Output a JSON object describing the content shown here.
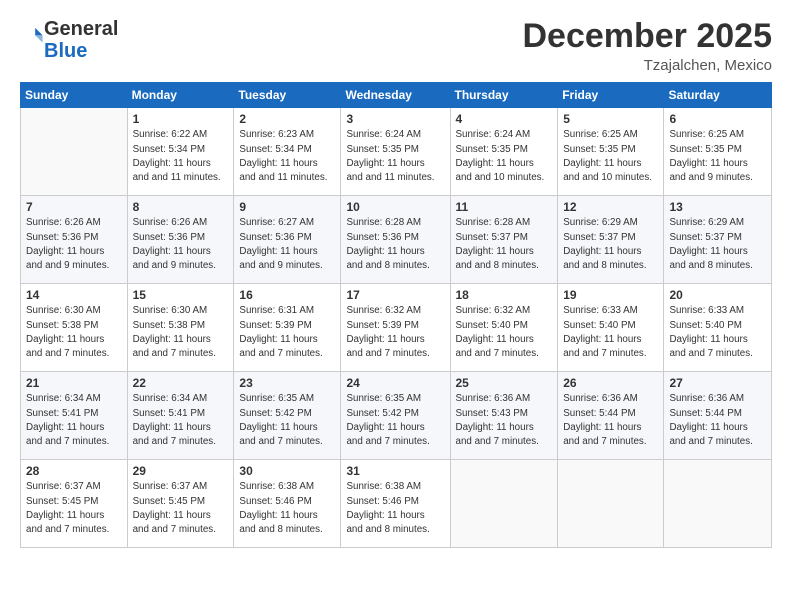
{
  "header": {
    "logo_general": "General",
    "logo_blue": "Blue",
    "month_title": "December 2025",
    "location": "Tzajalchen, Mexico"
  },
  "days_of_week": [
    "Sunday",
    "Monday",
    "Tuesday",
    "Wednesday",
    "Thursday",
    "Friday",
    "Saturday"
  ],
  "weeks": [
    [
      {
        "day": "",
        "sunrise": "",
        "sunset": "",
        "daylight": ""
      },
      {
        "day": "1",
        "sunrise": "Sunrise: 6:22 AM",
        "sunset": "Sunset: 5:34 PM",
        "daylight": "Daylight: 11 hours and 11 minutes."
      },
      {
        "day": "2",
        "sunrise": "Sunrise: 6:23 AM",
        "sunset": "Sunset: 5:34 PM",
        "daylight": "Daylight: 11 hours and 11 minutes."
      },
      {
        "day": "3",
        "sunrise": "Sunrise: 6:24 AM",
        "sunset": "Sunset: 5:35 PM",
        "daylight": "Daylight: 11 hours and 11 minutes."
      },
      {
        "day": "4",
        "sunrise": "Sunrise: 6:24 AM",
        "sunset": "Sunset: 5:35 PM",
        "daylight": "Daylight: 11 hours and 10 minutes."
      },
      {
        "day": "5",
        "sunrise": "Sunrise: 6:25 AM",
        "sunset": "Sunset: 5:35 PM",
        "daylight": "Daylight: 11 hours and 10 minutes."
      },
      {
        "day": "6",
        "sunrise": "Sunrise: 6:25 AM",
        "sunset": "Sunset: 5:35 PM",
        "daylight": "Daylight: 11 hours and 9 minutes."
      }
    ],
    [
      {
        "day": "7",
        "sunrise": "Sunrise: 6:26 AM",
        "sunset": "Sunset: 5:36 PM",
        "daylight": "Daylight: 11 hours and 9 minutes."
      },
      {
        "day": "8",
        "sunrise": "Sunrise: 6:26 AM",
        "sunset": "Sunset: 5:36 PM",
        "daylight": "Daylight: 11 hours and 9 minutes."
      },
      {
        "day": "9",
        "sunrise": "Sunrise: 6:27 AM",
        "sunset": "Sunset: 5:36 PM",
        "daylight": "Daylight: 11 hours and 9 minutes."
      },
      {
        "day": "10",
        "sunrise": "Sunrise: 6:28 AM",
        "sunset": "Sunset: 5:36 PM",
        "daylight": "Daylight: 11 hours and 8 minutes."
      },
      {
        "day": "11",
        "sunrise": "Sunrise: 6:28 AM",
        "sunset": "Sunset: 5:37 PM",
        "daylight": "Daylight: 11 hours and 8 minutes."
      },
      {
        "day": "12",
        "sunrise": "Sunrise: 6:29 AM",
        "sunset": "Sunset: 5:37 PM",
        "daylight": "Daylight: 11 hours and 8 minutes."
      },
      {
        "day": "13",
        "sunrise": "Sunrise: 6:29 AM",
        "sunset": "Sunset: 5:37 PM",
        "daylight": "Daylight: 11 hours and 8 minutes."
      }
    ],
    [
      {
        "day": "14",
        "sunrise": "Sunrise: 6:30 AM",
        "sunset": "Sunset: 5:38 PM",
        "daylight": "Daylight: 11 hours and 7 minutes."
      },
      {
        "day": "15",
        "sunrise": "Sunrise: 6:30 AM",
        "sunset": "Sunset: 5:38 PM",
        "daylight": "Daylight: 11 hours and 7 minutes."
      },
      {
        "day": "16",
        "sunrise": "Sunrise: 6:31 AM",
        "sunset": "Sunset: 5:39 PM",
        "daylight": "Daylight: 11 hours and 7 minutes."
      },
      {
        "day": "17",
        "sunrise": "Sunrise: 6:32 AM",
        "sunset": "Sunset: 5:39 PM",
        "daylight": "Daylight: 11 hours and 7 minutes."
      },
      {
        "day": "18",
        "sunrise": "Sunrise: 6:32 AM",
        "sunset": "Sunset: 5:40 PM",
        "daylight": "Daylight: 11 hours and 7 minutes."
      },
      {
        "day": "19",
        "sunrise": "Sunrise: 6:33 AM",
        "sunset": "Sunset: 5:40 PM",
        "daylight": "Daylight: 11 hours and 7 minutes."
      },
      {
        "day": "20",
        "sunrise": "Sunrise: 6:33 AM",
        "sunset": "Sunset: 5:40 PM",
        "daylight": "Daylight: 11 hours and 7 minutes."
      }
    ],
    [
      {
        "day": "21",
        "sunrise": "Sunrise: 6:34 AM",
        "sunset": "Sunset: 5:41 PM",
        "daylight": "Daylight: 11 hours and 7 minutes."
      },
      {
        "day": "22",
        "sunrise": "Sunrise: 6:34 AM",
        "sunset": "Sunset: 5:41 PM",
        "daylight": "Daylight: 11 hours and 7 minutes."
      },
      {
        "day": "23",
        "sunrise": "Sunrise: 6:35 AM",
        "sunset": "Sunset: 5:42 PM",
        "daylight": "Daylight: 11 hours and 7 minutes."
      },
      {
        "day": "24",
        "sunrise": "Sunrise: 6:35 AM",
        "sunset": "Sunset: 5:42 PM",
        "daylight": "Daylight: 11 hours and 7 minutes."
      },
      {
        "day": "25",
        "sunrise": "Sunrise: 6:36 AM",
        "sunset": "Sunset: 5:43 PM",
        "daylight": "Daylight: 11 hours and 7 minutes."
      },
      {
        "day": "26",
        "sunrise": "Sunrise: 6:36 AM",
        "sunset": "Sunset: 5:44 PM",
        "daylight": "Daylight: 11 hours and 7 minutes."
      },
      {
        "day": "27",
        "sunrise": "Sunrise: 6:36 AM",
        "sunset": "Sunset: 5:44 PM",
        "daylight": "Daylight: 11 hours and 7 minutes."
      }
    ],
    [
      {
        "day": "28",
        "sunrise": "Sunrise: 6:37 AM",
        "sunset": "Sunset: 5:45 PM",
        "daylight": "Daylight: 11 hours and 7 minutes."
      },
      {
        "day": "29",
        "sunrise": "Sunrise: 6:37 AM",
        "sunset": "Sunset: 5:45 PM",
        "daylight": "Daylight: 11 hours and 7 minutes."
      },
      {
        "day": "30",
        "sunrise": "Sunrise: 6:38 AM",
        "sunset": "Sunset: 5:46 PM",
        "daylight": "Daylight: 11 hours and 8 minutes."
      },
      {
        "day": "31",
        "sunrise": "Sunrise: 6:38 AM",
        "sunset": "Sunset: 5:46 PM",
        "daylight": "Daylight: 11 hours and 8 minutes."
      },
      {
        "day": "",
        "sunrise": "",
        "sunset": "",
        "daylight": ""
      },
      {
        "day": "",
        "sunrise": "",
        "sunset": "",
        "daylight": ""
      },
      {
        "day": "",
        "sunrise": "",
        "sunset": "",
        "daylight": ""
      }
    ]
  ]
}
